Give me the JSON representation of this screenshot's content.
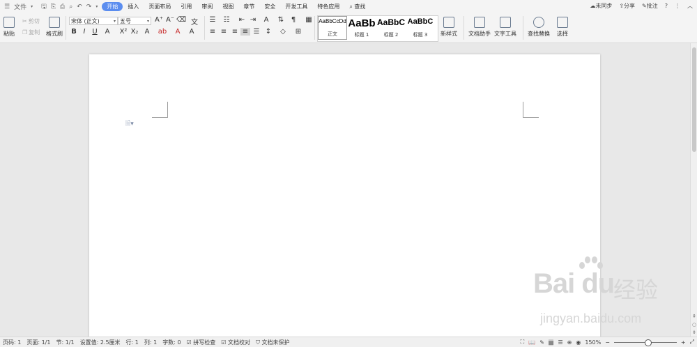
{
  "menubar": {
    "file_label": "文件",
    "tabs": [
      "开始",
      "插入",
      "页面布局",
      "引用",
      "审阅",
      "视图",
      "章节",
      "安全",
      "开发工具",
      "特色应用"
    ],
    "active_tab": "开始",
    "search_label": "查找",
    "sync_label": "未同步",
    "share_label": "分享",
    "comment_label": "批注"
  },
  "ribbon": {
    "paste_label": "粘贴",
    "cut_label": "剪切",
    "copy_label": "复制",
    "format_painter_label": "格式刷",
    "font_name": "宋体 (正文)",
    "font_size": "五号",
    "styles": [
      {
        "preview": "AaBbCcDd",
        "name": "正文"
      },
      {
        "preview": "AaBb",
        "name": "标题 1"
      },
      {
        "preview": "AaBbC",
        "name": "标题 2"
      },
      {
        "preview": "AaBbC",
        "name": "标题 3"
      }
    ],
    "new_style_label": "新样式",
    "doc_helper_label": "文档助手",
    "text_tools_label": "文字工具",
    "find_replace_label": "查找替换",
    "select_label": "选择"
  },
  "status": {
    "page_code": "页码: 1",
    "pages": "页面: 1/1",
    "section": "节: 1/1",
    "setting": "设置值: 2.5厘米",
    "row": "行: 1",
    "col": "列: 1",
    "word_count": "字数: 0",
    "spell_check": "拼写检查",
    "doc_check": "文档校对",
    "protect": "文档未保护",
    "zoom": "150%"
  },
  "watermark": {
    "logo_text": "Bai du",
    "cn_text": "经验",
    "url": "jingyan.baidu.com"
  }
}
